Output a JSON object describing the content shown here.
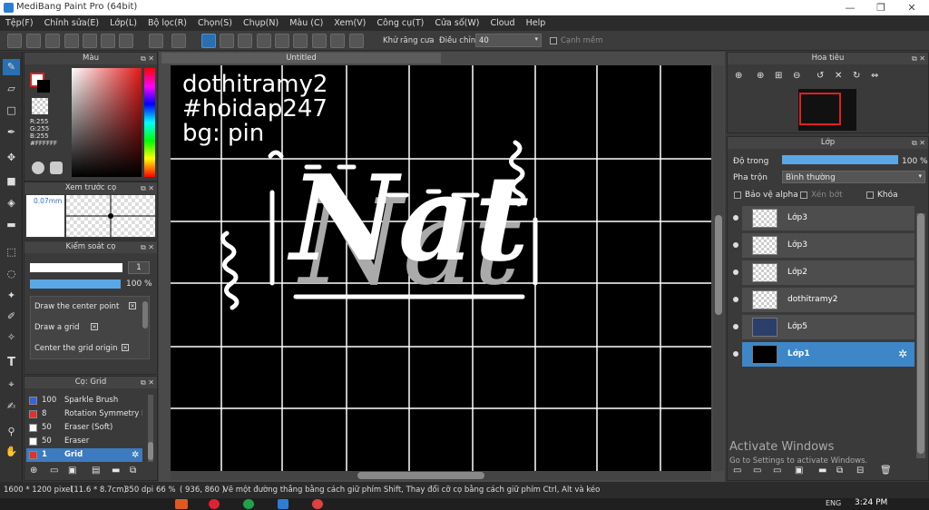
{
  "window": {
    "title": "MediBang Paint Pro (64bit)",
    "minimize": "—",
    "maximize": "❐",
    "close": "✕"
  },
  "menu": [
    "Tệp(F)",
    "Chỉnh sửa(E)",
    "Lớp(L)",
    "Bộ lọc(R)",
    "Chọn(S)",
    "Chụp(N)",
    "Màu (C)",
    "Xem(V)",
    "Công cụ(T)",
    "Cửa số(W)",
    "Cloud",
    "Help"
  ],
  "toolbar": {
    "antialias_label": "Khử răng cưa",
    "correction_label": "Điều chỉnh",
    "correction_value": "40",
    "edge_label": "Cạnh mềm"
  },
  "color_panel": {
    "title": "Màu",
    "r": "R:255",
    "g": "G:255",
    "b": "B:255",
    "hex": "#FFFFFF"
  },
  "brush_preview": {
    "title": "Xem trước cọ",
    "size": "0.07mm"
  },
  "brush_control": {
    "title": "Kiểm soát cọ",
    "size_value": "1",
    "opacity_value": "100 %",
    "options": [
      "Draw the center point",
      "Draw a grid",
      "Center the grid origin"
    ]
  },
  "brush_list": {
    "title": "Cọ: Grid",
    "items": [
      {
        "size": "100",
        "name": "Sparkle Brush",
        "color": "#3a5fe0"
      },
      {
        "size": "8",
        "name": "Rotation Symmetry P",
        "color": "#e03030"
      },
      {
        "size": "50",
        "name": "Eraser (Soft)",
        "color": "#ffffff"
      },
      {
        "size": "50",
        "name": "Eraser",
        "color": "#ffffff"
      },
      {
        "size": "1",
        "name": "Grid",
        "color": "#e03030"
      }
    ]
  },
  "canvas": {
    "tab_title": "Untitled",
    "text_lines": [
      "dothitramy2",
      "#hoidap247",
      "bg: pin"
    ],
    "art_text": "Nat"
  },
  "navigator": {
    "title": "Hoa tiêu"
  },
  "layers": {
    "title": "Lớp",
    "opacity_label": "Độ trong",
    "opacity_value": "100 %",
    "blend_label": "Pha trộn",
    "blend_value": "Bình thường",
    "protect_alpha": "Bảo vệ alpha",
    "clipping": "Xén bớt",
    "lock": "Khóa",
    "items": [
      "Lớp3",
      "Lớp3",
      "Lớp2",
      "dothitramy2",
      "Lớp5",
      "Lớp1"
    ],
    "selected_index": 5
  },
  "watermark": {
    "line1": "Activate Windows",
    "line2": "Go to Settings to activate Windows."
  },
  "status": {
    "dims": "1600 * 1200 pixel",
    "physical": "(11.6 * 8.7cm)",
    "dpi": "350 dpi",
    "zoom": "66 %",
    "coords": "( 936, 860 )",
    "hint": "Vẽ một đường thẳng bằng cách giữ phím Shift, Thay đổi cỡ cọ bằng cách giữ phím Ctrl, Alt và kéo"
  },
  "taskbar": {
    "lang": "ENG",
    "time": "3:24 PM"
  },
  "colors": {
    "accent": "#3d87c8",
    "panel_bg": "#3a3a3a",
    "canvas_bg": "#000000"
  }
}
